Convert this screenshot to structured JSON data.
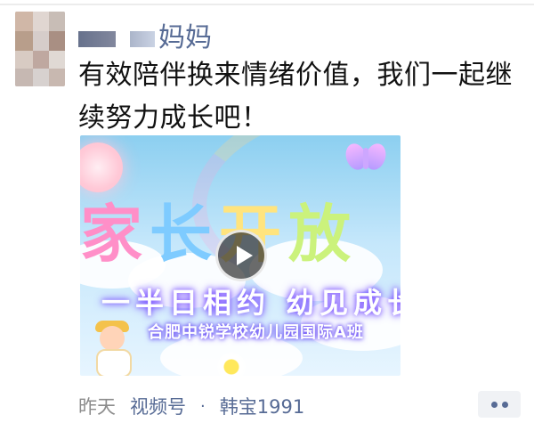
{
  "post": {
    "name_text": "妈妈",
    "content": "有效陪伴换来情绪价值，我们一起继续努力成长吧！"
  },
  "media": {
    "title": [
      "家",
      "长",
      "开",
      "放"
    ],
    "subtitle": "一半日相约  幼见成长",
    "school": "合肥中锐学校幼儿园国际A班",
    "play_icon": "play-icon"
  },
  "footer": {
    "time": "昨天",
    "channel": "视频号",
    "separator": "·",
    "author": "韩宝1991",
    "more_icon": "more-icon"
  },
  "colors": {
    "name": "#576b95",
    "text": "#111111",
    "meta": "#8c8c8c"
  }
}
